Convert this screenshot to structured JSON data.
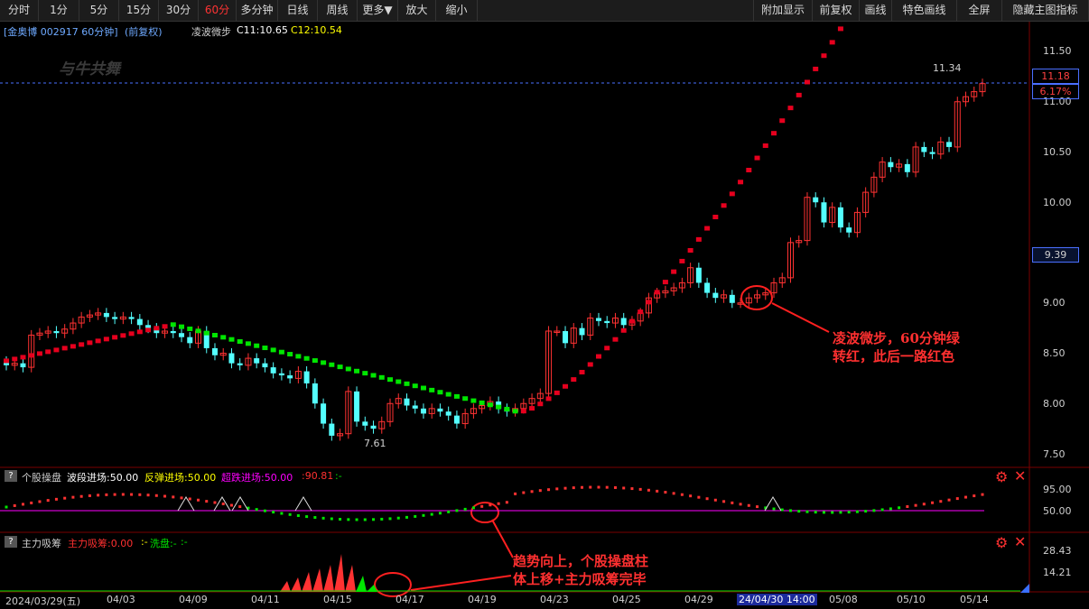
{
  "toolbar": {
    "left_items": [
      "分时",
      "1分",
      "5分",
      "15分",
      "30分",
      "60分",
      "多分钟",
      "日线",
      "周线",
      "更多▼",
      "放大",
      "缩小"
    ],
    "active": "60分",
    "right_items": [
      "附加显示",
      "前复权",
      "画线",
      "特色画线",
      "全屏",
      "隐藏主图指标"
    ]
  },
  "main": {
    "stock_title": "[金奥博 002917 60分钟]",
    "adjust": "(前复权)",
    "indicator_name": "凌波微步",
    "c1": "C11:10.65",
    "c2": "C12:10.54",
    "watermark": "与牛共舞",
    "high_label": "11.34",
    "low_label": "7.61",
    "price_tag": "11.18",
    "pct_tag": "6.17%",
    "cursor_price": "9.39",
    "y_ticks": [
      "11.50",
      "11.00",
      "10.50",
      "10.00",
      "9.00",
      "8.50",
      "8.00",
      "7.50"
    ],
    "annotation1_line1": "凌波微步，60分钟绿",
    "annotation1_line2": "转红，此后一路红色"
  },
  "panel2": {
    "name": "个股操盘",
    "label1": "波段进场:50.00",
    "label2": "反弹进场:50.00",
    "label3": "超跌进场:50.00",
    "label4": ":90.81",
    "label5": ":-",
    "y_ticks": [
      "95.00",
      "50.00"
    ]
  },
  "panel3": {
    "name": "主力吸筹",
    "label1": "主力吸筹:0.00",
    "label2": ":-",
    "label3": "洗盘:-",
    "label4": ":-",
    "y_ticks": [
      "28.43",
      "14.21"
    ],
    "annotation2_line1": "趋势向上，个股操盘柱",
    "annotation2_line2": "体上移+主力吸筹完毕"
  },
  "x_axis": {
    "labels": [
      "2024/03/29(五)",
      "04/03",
      "04/09",
      "04/11",
      "04/15",
      "04/17",
      "04/19",
      "04/23",
      "04/25",
      "04/29",
      "24/04/30 14:00",
      "05/08",
      "05/10",
      "05/14"
    ]
  },
  "colors": {
    "up": "#ff3232",
    "down": "#54ffff",
    "green": "#00e600",
    "red_line": "#e6001e",
    "magenta": "#ff00ff",
    "grid": "#3a0000"
  },
  "chart_data": {
    "type": "candlestick",
    "interval": "60分钟",
    "ylim": [
      7.4,
      11.6
    ],
    "high": 11.34,
    "low": 7.61,
    "last_close": 11.18,
    "change_pct": "6.17%"
  }
}
